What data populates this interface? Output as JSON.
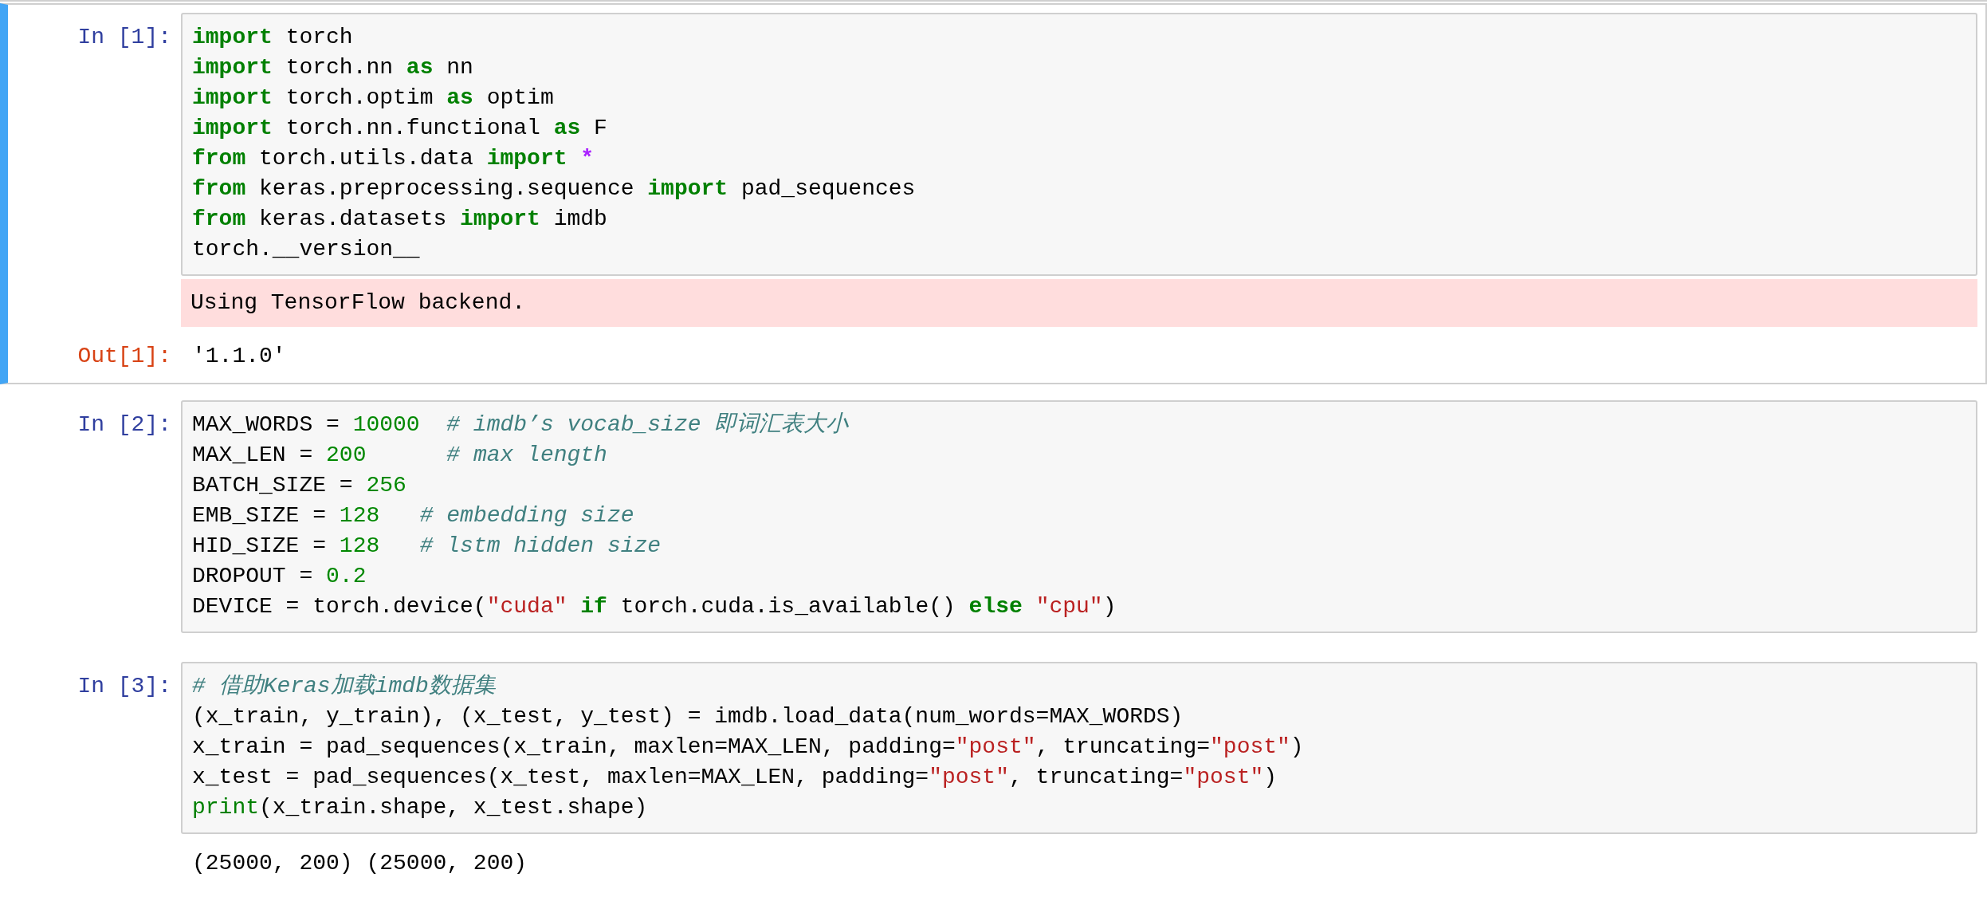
{
  "cells": [
    {
      "prompt": "In [1]:",
      "selected": true,
      "lines": [
        [
          {
            "kind": "kw",
            "t": "import"
          },
          {
            "kind": "p",
            "t": " torch"
          }
        ],
        [
          {
            "kind": "kw",
            "t": "import"
          },
          {
            "kind": "p",
            "t": " torch.nn "
          },
          {
            "kind": "kw",
            "t": "as"
          },
          {
            "kind": "p",
            "t": " nn"
          }
        ],
        [
          {
            "kind": "kw",
            "t": "import"
          },
          {
            "kind": "p",
            "t": " torch.optim "
          },
          {
            "kind": "kw",
            "t": "as"
          },
          {
            "kind": "p",
            "t": " optim"
          }
        ],
        [
          {
            "kind": "kw",
            "t": "import"
          },
          {
            "kind": "p",
            "t": " torch.nn.functional "
          },
          {
            "kind": "kw",
            "t": "as"
          },
          {
            "kind": "p",
            "t": " F"
          }
        ],
        [
          {
            "kind": "kw",
            "t": "from"
          },
          {
            "kind": "p",
            "t": " torch.utils.data "
          },
          {
            "kind": "kw",
            "t": "import"
          },
          {
            "kind": "op",
            "t": " *"
          }
        ],
        [
          {
            "kind": "kw",
            "t": "from"
          },
          {
            "kind": "p",
            "t": " keras.preprocessing.sequence "
          },
          {
            "kind": "kw",
            "t": "import"
          },
          {
            "kind": "p",
            "t": " pad_sequences"
          }
        ],
        [
          {
            "kind": "kw",
            "t": "from"
          },
          {
            "kind": "p",
            "t": " keras.datasets "
          },
          {
            "kind": "kw",
            "t": "import"
          },
          {
            "kind": "p",
            "t": " imdb"
          }
        ],
        [
          {
            "kind": "p",
            "t": "torch.__version__"
          }
        ]
      ],
      "outputs": [
        {
          "kind": "stderr",
          "text": "Using TensorFlow backend."
        },
        {
          "kind": "result",
          "prompt": "Out[1]:",
          "text": "'1.1.0'"
        }
      ]
    },
    {
      "prompt": "In [2]:",
      "selected": false,
      "lines": [
        [
          {
            "kind": "p",
            "t": "MAX_WORDS = "
          },
          {
            "kind": "num",
            "t": "10000"
          },
          {
            "kind": "cm",
            "t": "  # imdb’s vocab_size 即词汇表大小"
          }
        ],
        [
          {
            "kind": "p",
            "t": "MAX_LEN = "
          },
          {
            "kind": "num",
            "t": "200"
          },
          {
            "kind": "cm",
            "t": "      # max length"
          }
        ],
        [
          {
            "kind": "p",
            "t": "BATCH_SIZE = "
          },
          {
            "kind": "num",
            "t": "256"
          }
        ],
        [
          {
            "kind": "p",
            "t": "EMB_SIZE = "
          },
          {
            "kind": "num",
            "t": "128"
          },
          {
            "kind": "cm",
            "t": "   # embedding size"
          }
        ],
        [
          {
            "kind": "p",
            "t": "HID_SIZE = "
          },
          {
            "kind": "num",
            "t": "128"
          },
          {
            "kind": "cm",
            "t": "   # lstm hidden size"
          }
        ],
        [
          {
            "kind": "p",
            "t": "DROPOUT = "
          },
          {
            "kind": "num",
            "t": "0.2"
          }
        ],
        [
          {
            "kind": "p",
            "t": "DEVICE = torch.device("
          },
          {
            "kind": "str",
            "t": "\"cuda\""
          },
          {
            "kind": "kw",
            "t": " if"
          },
          {
            "kind": "p",
            "t": " torch.cuda.is_available() "
          },
          {
            "kind": "kw",
            "t": "else"
          },
          {
            "kind": "str",
            "t": " \"cpu\""
          },
          {
            "kind": "p",
            "t": ")"
          }
        ]
      ]
    },
    {
      "prompt": "In [3]:",
      "selected": false,
      "lines": [
        [
          {
            "kind": "cm",
            "t": "# 借助Keras加载imdb数据集"
          }
        ],
        [
          {
            "kind": "p",
            "t": "(x_train, y_train), (x_test, y_test) = imdb.load_data(num_words=MAX_WORDS)"
          }
        ],
        [
          {
            "kind": "p",
            "t": "x_train = pad_sequences(x_train, maxlen=MAX_LEN, padding="
          },
          {
            "kind": "str",
            "t": "\"post\""
          },
          {
            "kind": "p",
            "t": ", truncating="
          },
          {
            "kind": "str",
            "t": "\"post\""
          },
          {
            "kind": "p",
            "t": ")"
          }
        ],
        [
          {
            "kind": "p",
            "t": "x_test = pad_sequences(x_test, maxlen=MAX_LEN, padding="
          },
          {
            "kind": "str",
            "t": "\"post\""
          },
          {
            "kind": "p",
            "t": ", truncating="
          },
          {
            "kind": "str",
            "t": "\"post\""
          },
          {
            "kind": "p",
            "t": ")"
          }
        ],
        [
          {
            "kind": "bi",
            "t": "print"
          },
          {
            "kind": "p",
            "t": "(x_train.shape, x_test.shape)"
          }
        ]
      ],
      "outputs": [
        {
          "kind": "stream",
          "text": "(25000, 200) (25000, 200)"
        }
      ]
    }
  ]
}
